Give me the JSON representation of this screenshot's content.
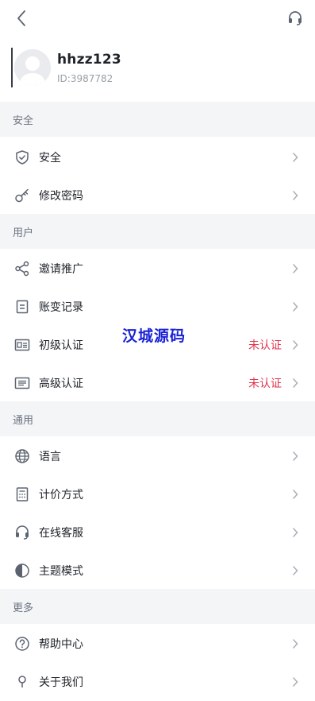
{
  "header": {
    "back_icon": "chevron-left-icon",
    "support_icon": "headset-icon"
  },
  "profile": {
    "username": "hhzz123",
    "user_id": "ID:3987782"
  },
  "sections": {
    "security": {
      "title": "安全",
      "items": [
        {
          "label": "安全",
          "icon": "shield-check-icon"
        },
        {
          "label": "修改密码",
          "icon": "key-icon"
        }
      ]
    },
    "user": {
      "title": "用户",
      "items": [
        {
          "label": "邀请推广",
          "icon": "share-icon"
        },
        {
          "label": "账变记录",
          "icon": "document-icon"
        },
        {
          "label": "初级认证",
          "icon": "id-card-icon",
          "status": "未认证"
        },
        {
          "label": "高级认证",
          "icon": "id-card-lines-icon",
          "status": "未认证"
        }
      ]
    },
    "general": {
      "title": "通用",
      "items": [
        {
          "label": "语言",
          "icon": "globe-icon"
        },
        {
          "label": "计价方式",
          "icon": "calculator-icon"
        },
        {
          "label": "在线客服",
          "icon": "headset-icon"
        },
        {
          "label": "主题模式",
          "icon": "half-circle-icon"
        }
      ]
    },
    "more": {
      "title": "更多",
      "items": [
        {
          "label": "帮助中心",
          "icon": "question-circle-icon"
        },
        {
          "label": "关于我们",
          "icon": "info-icon"
        }
      ]
    }
  },
  "watermark": "汉城源码",
  "colors": {
    "status_red": "#e0364f",
    "watermark_blue": "#1a22d6",
    "section_bg": "#f4f5f7"
  }
}
